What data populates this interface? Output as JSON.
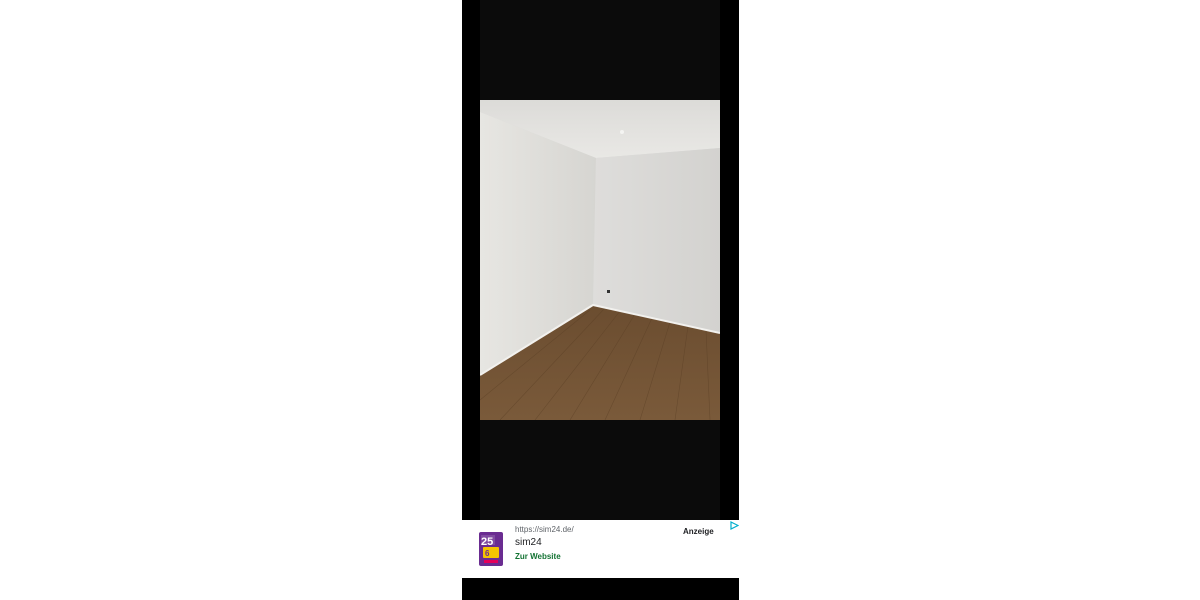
{
  "photo": {
    "subject": "empty-room-photo"
  },
  "ad": {
    "url": "https://sim24.de/",
    "label": "Anzeige",
    "advertiser": "sim24",
    "cta": "Zur Website",
    "thumb_icon": "sim24-ad-thumbnail",
    "choices_icon": "ad-choices-icon",
    "cta_color": "#137333",
    "choices_color": "#00aecd"
  },
  "colors": {
    "viewer_background": "#000000",
    "page_background": "#ffffff"
  }
}
